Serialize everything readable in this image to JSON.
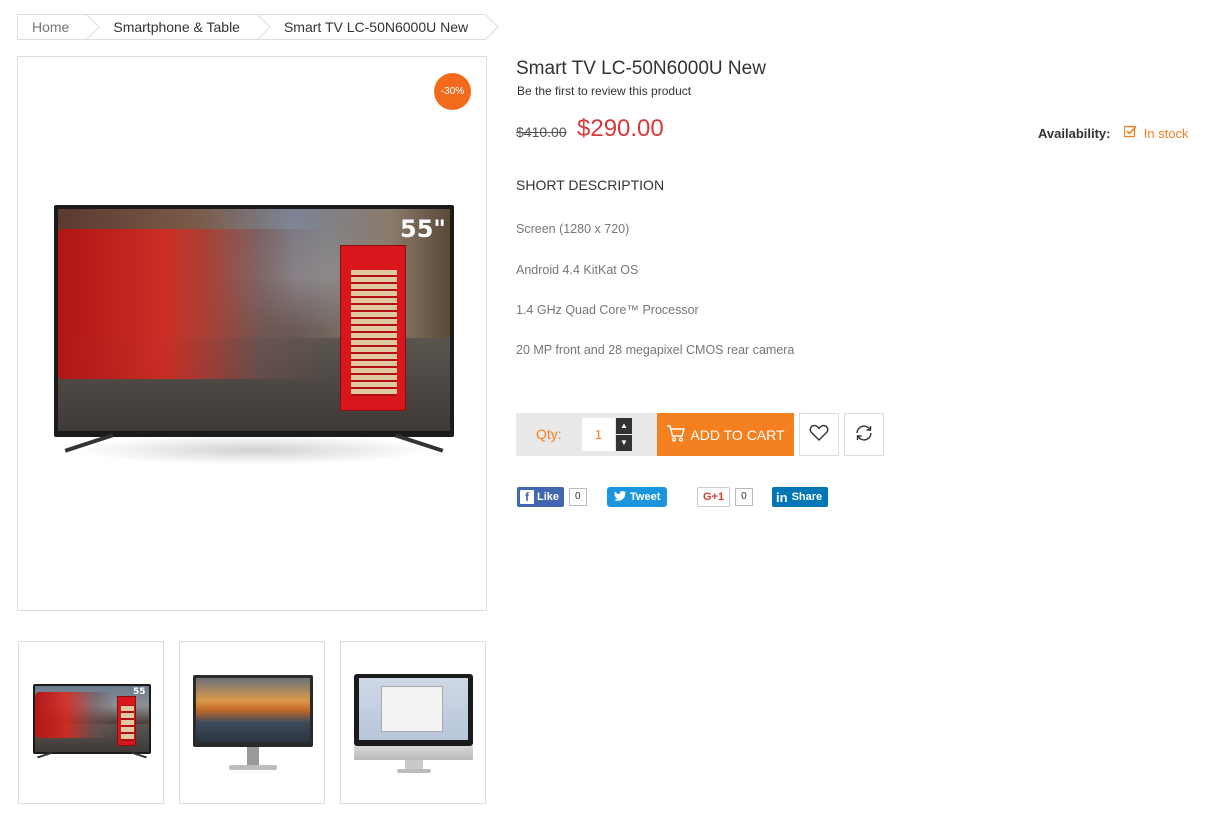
{
  "breadcrumb": {
    "items": [
      "Home",
      "Smartphone & Table",
      "Smart TV LC-50N6000U New"
    ]
  },
  "product": {
    "title": "Smart TV LC-50N6000U New",
    "review_link": "Be the first to review this product",
    "old_price": "$410.00",
    "price": "$290.00",
    "availability_label": "Availability:",
    "availability_value": "In stock",
    "sale_badge": "-30%",
    "tv_size_badge": "55\"",
    "tv_size_badge_small": "55"
  },
  "short_description": {
    "title": "SHORT DESCRIPTION",
    "lines": [
      "Screen (1280 x 720)",
      "Android 4.4 KitKat OS",
      "1.4 GHz Quad Core™ Processor",
      "20 MP front and 28 megapixel CMOS rear camera"
    ]
  },
  "cart": {
    "qty_label": "Qty:",
    "qty_value": "1",
    "add_to_cart": "ADD TO CART",
    "qty_up_icon": "caret-up-icon",
    "qty_down_icon": "caret-down-icon",
    "cart_icon": "cart-icon",
    "wishlist_icon": "heart-icon",
    "compare_icon": "refresh-icon"
  },
  "social": {
    "facebook_label": "Like",
    "facebook_count": "0",
    "twitter_label": "Tweet",
    "gplus_label": "G+1",
    "gplus_count": "0",
    "linkedin_label": "Share",
    "linkedin_logo": "in"
  },
  "colors": {
    "accent": "#f58020",
    "price": "#d9383a",
    "badge": "#f26b1d",
    "facebook": "#4267b2",
    "twitter": "#1b95e0",
    "linkedin": "#0077b5"
  }
}
